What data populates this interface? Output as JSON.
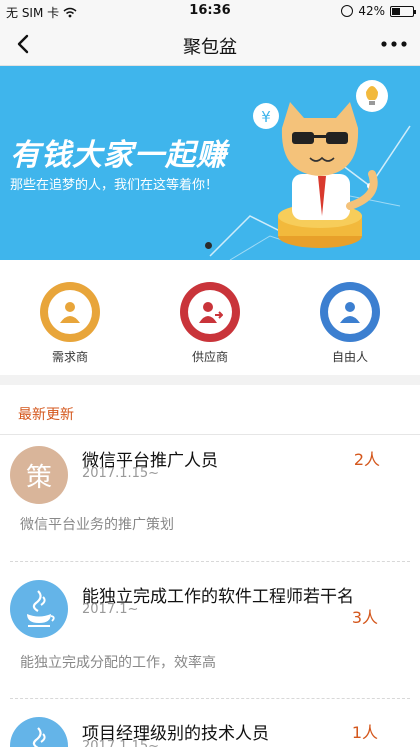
{
  "status": {
    "carrier": "无 SIM 卡",
    "time": "16:36",
    "battery_text": "42%",
    "battery_level": 0.42
  },
  "nav": {
    "title": "聚包盆"
  },
  "banner": {
    "headline": "有钱大家一起赚",
    "subtitle": "那些在追梦的人，我们在这等着你！"
  },
  "categories": [
    {
      "label": "需求商",
      "color": "#e8a53a"
    },
    {
      "label": "供应商",
      "color": "#c9343a"
    },
    {
      "label": "自由人",
      "color": "#3c7fd0"
    }
  ],
  "section": {
    "title": "最新更新"
  },
  "listings": [
    {
      "avatar_char": "策",
      "avatar_color": "#d9b59a",
      "name": "微信平台推广人员",
      "date": "2017.1.15~",
      "count": "2人",
      "desc": "微信平台业务的推广策划"
    },
    {
      "avatar_char": "java",
      "avatar_color": "#64b4e8",
      "name": "能独立完成工作的软件工程师若干名",
      "date": "2017.1~",
      "count": "3人",
      "desc": "能独立完成分配的工作，效率高"
    },
    {
      "avatar_char": "java",
      "avatar_color": "#64b4e8",
      "name": "项目经理级别的技术人员",
      "date": "2017.1.15~",
      "count": "1人",
      "desc": ""
    }
  ]
}
